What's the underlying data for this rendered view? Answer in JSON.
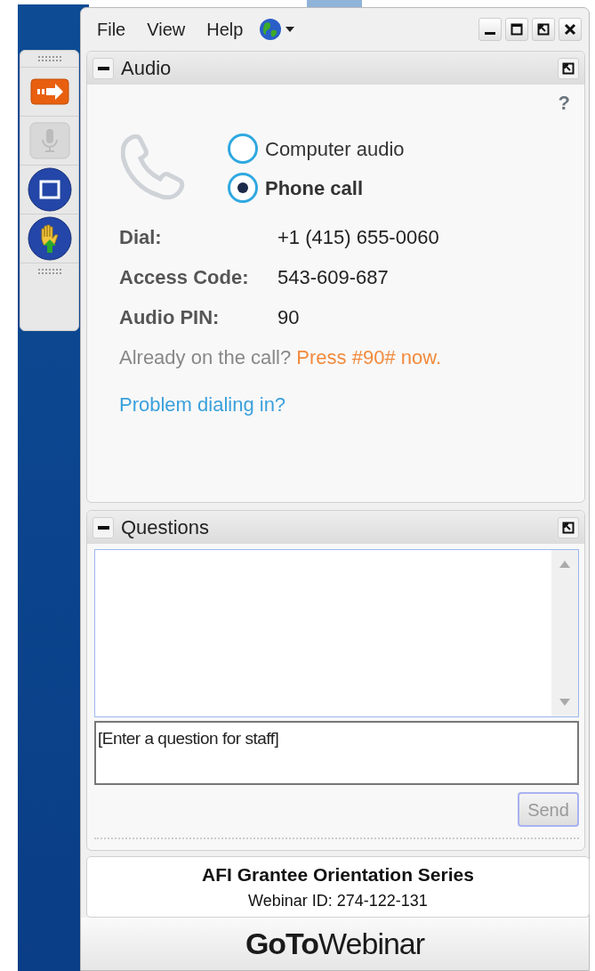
{
  "menu": [
    {
      "label": "File"
    },
    {
      "label": "View"
    },
    {
      "label": "Help"
    }
  ],
  "audio": {
    "title": "Audio",
    "help": "?",
    "options": [
      {
        "label": "Computer audio",
        "selected": false
      },
      {
        "label": "Phone call",
        "selected": true
      }
    ],
    "details": [
      {
        "label": "Dial:",
        "value": "+1 (415) 655-0060"
      },
      {
        "label": "Access Code:",
        "value": "543-609-687"
      },
      {
        "label": "Audio PIN:",
        "value": "90"
      }
    ],
    "already_text": "Already on the call?",
    "press_text": "Press #90# now.",
    "problem_link": "Problem dialing in?"
  },
  "questions": {
    "title": "Questions",
    "placeholder": "[Enter a question for staff]",
    "send": {
      "label": "Send",
      "disabled": true
    }
  },
  "footer": {
    "title": "AFI Grantee Orientation Series",
    "webinar_id": "Webinar ID: 274-122-131",
    "logo": "**GoTo**Webinar"
  }
}
